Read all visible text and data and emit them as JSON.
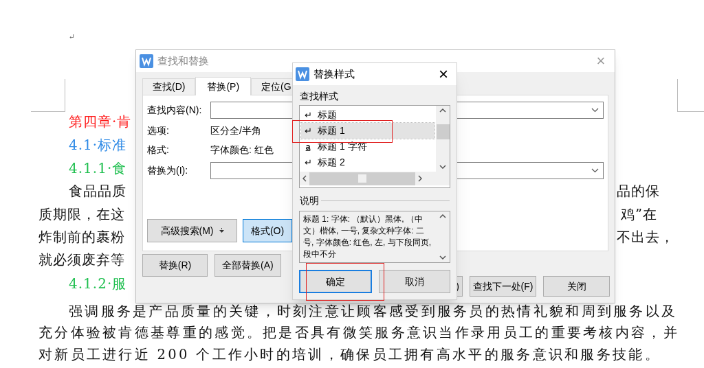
{
  "document": {
    "paragraph_mark": "↵",
    "lines": [
      {
        "kind": "heading1",
        "text": "第四章·肯"
      },
      {
        "kind": "heading2",
        "text": "4.1·标准"
      },
      {
        "kind": "heading3",
        "text": "4.1.1·食"
      },
      {
        "kind": "body",
        "text": "食品品质",
        "text_right": "品的保"
      },
      {
        "kind": "body",
        "text": "质期限，在这",
        "text_right": "鸡”在"
      },
      {
        "kind": "body",
        "text": "炸制前的裹粉",
        "text_right": "不出去，"
      },
      {
        "kind": "body",
        "text": "就必须废弃等"
      },
      {
        "kind": "heading3",
        "text": "4.1.2·服"
      },
      {
        "kind": "body",
        "text": "强调服务是产品质量的关键，时刻注意让顾客感受到服务员的热情礼貌和周到服务以及"
      },
      {
        "kind": "body",
        "text": "充分体验被肯德基尊重的感觉。把是否具有微笑服务意识当作录用员工的重要考核内容，并"
      },
      {
        "kind": "body",
        "text": "对新员工进行近 200 个工作小时的培训，确保员工拥有高水平的服务意识和服务技能。"
      }
    ]
  },
  "find_replace_dialog": {
    "title": "查找和替换",
    "close": "×",
    "tabs": [
      {
        "label": "查找(D)",
        "selected": false
      },
      {
        "label": "替换(P)",
        "selected": true
      },
      {
        "label": "定位(G",
        "selected": false
      }
    ],
    "find_label": "查找内容(N):",
    "options_label": "选项:",
    "options_value": "区分全/半角",
    "format_label": "格式:",
    "format_value": "字体颜色: 红色",
    "replace_label": "替换为(I):",
    "buttons_middle": [
      {
        "label": "高级搜索(M)",
        "dropdown": true,
        "focused": false
      },
      {
        "label": "格式(O)",
        "dropdown": false,
        "focused": true
      }
    ],
    "buttons_bottom_left": [
      "替换(R)",
      "全部替换(A)"
    ],
    "buttons_bottom_right": [
      ")",
      "查找下一处(F)",
      "关闭"
    ]
  },
  "style_dialog": {
    "title": "替换样式",
    "close": "×",
    "list_label": "查找样式",
    "styles": [
      {
        "marker": "↵",
        "kind": "paragraph",
        "label": "标题",
        "selected": false
      },
      {
        "marker": "↵",
        "kind": "paragraph",
        "label": "标题 1",
        "selected": true
      },
      {
        "marker": "a",
        "kind": "character",
        "label": "标题 1 字符",
        "selected": false
      },
      {
        "marker": "↵",
        "kind": "paragraph",
        "label": "标题 2",
        "selected": false
      }
    ],
    "description_label": "说明",
    "description": "标题 1: 字体: （默认）黑体, （中文）楷体, 一号, 复杂文种字体: 二号, 字体颜色: 红色, 左, 与下段同页, 段中不分",
    "ok": "确定",
    "cancel": "取消"
  }
}
